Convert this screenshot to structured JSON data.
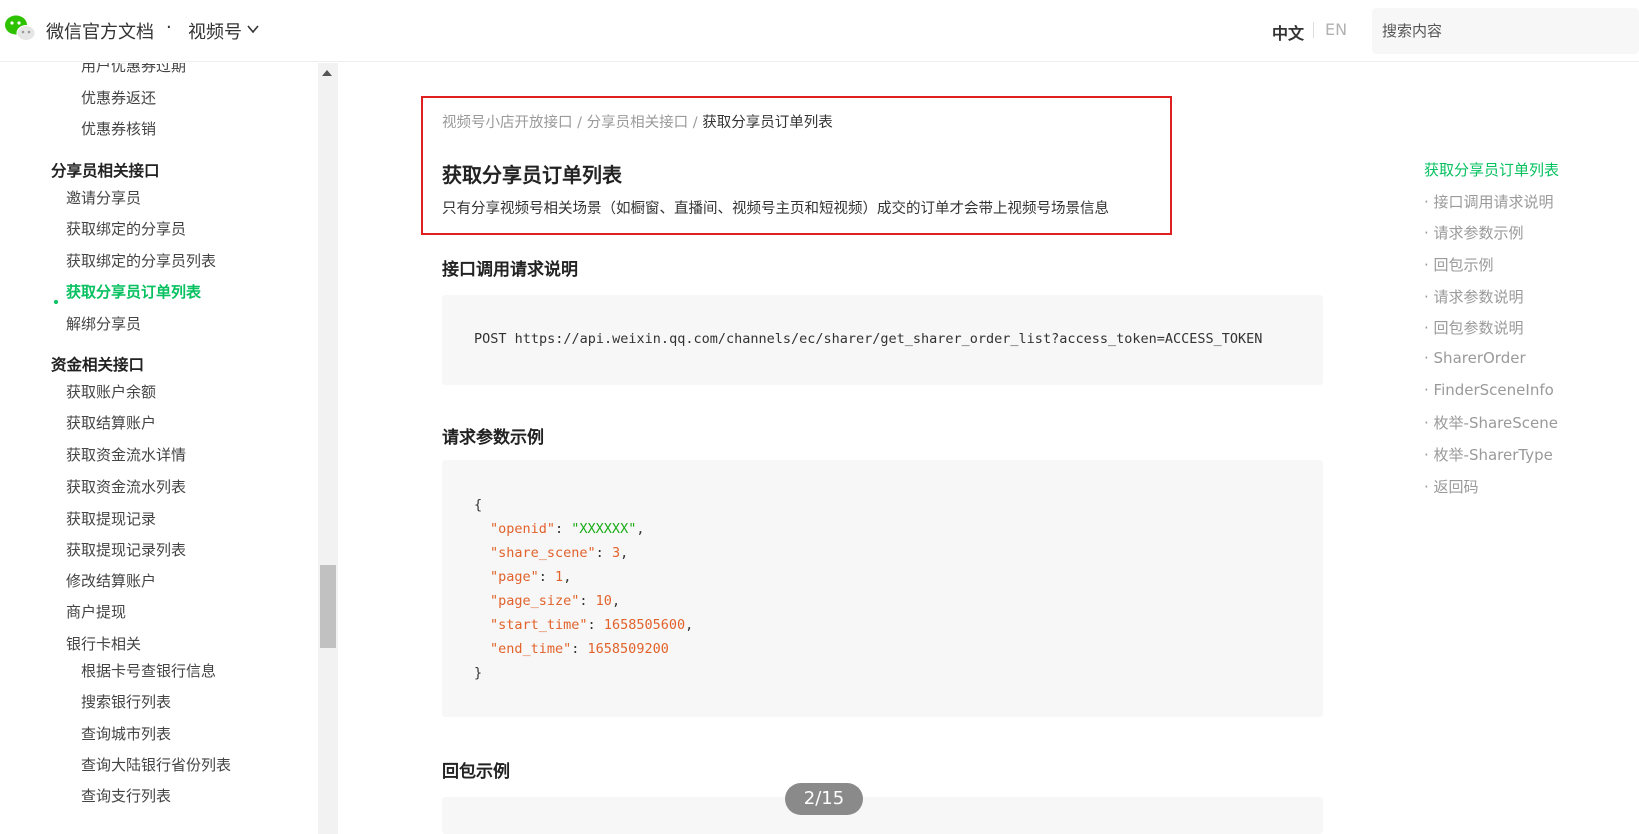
{
  "header": {
    "site_title": "微信官方文档",
    "separator": "·",
    "section_title": "视频号",
    "lang_zh": "中文",
    "lang_en": "EN",
    "search_placeholder": "搜索内容"
  },
  "sidebar": {
    "items": [
      {
        "label": "用户优惠券过期",
        "level": 2
      },
      {
        "label": "优惠券返还",
        "level": 2
      },
      {
        "label": "优惠券核销",
        "level": 2
      },
      {
        "label": "分享员相关接口",
        "level": 0
      },
      {
        "label": "邀请分享员",
        "level": 1
      },
      {
        "label": "获取绑定的分享员",
        "level": 1
      },
      {
        "label": "获取绑定的分享员列表",
        "level": 1
      },
      {
        "label": "获取分享员订单列表",
        "level": 1,
        "active": true
      },
      {
        "label": "解绑分享员",
        "level": 1
      },
      {
        "label": "资金相关接口",
        "level": 0
      },
      {
        "label": "获取账户余额",
        "level": 1
      },
      {
        "label": "获取结算账户",
        "level": 1
      },
      {
        "label": "获取资金流水详情",
        "level": 1
      },
      {
        "label": "获取资金流水列表",
        "level": 1
      },
      {
        "label": "获取提现记录",
        "level": 1
      },
      {
        "label": "获取提现记录列表",
        "level": 1
      },
      {
        "label": "修改结算账户",
        "level": 1
      },
      {
        "label": "商户提现",
        "level": 1
      },
      {
        "label": "银行卡相关",
        "level": 1
      },
      {
        "label": "根据卡号查银行信息",
        "level": 2
      },
      {
        "label": "搜索银行列表",
        "level": 2
      },
      {
        "label": "查询城市列表",
        "level": 2
      },
      {
        "label": "查询大陆银行省份列表",
        "level": 2
      },
      {
        "label": "查询支行列表",
        "level": 2
      }
    ]
  },
  "breadcrumb": {
    "items": [
      "视频号小店开放接口",
      "分享员相关接口",
      "获取分享员订单列表"
    ],
    "separator": "/"
  },
  "main": {
    "title": "获取分享员订单列表",
    "description": "只有分享视频号相关场景（如橱窗、直播间、视频号主页和短视频）成交的订单才会带上视频号场景信息",
    "section1_title": "接口调用请求说明",
    "request_line": "POST https://api.weixin.qq.com/channels/ec/sharer/get_sharer_order_list?access_token=ACCESS_TOKEN",
    "section2_title": "请求参数示例",
    "json_example": {
      "open": "{",
      "close": "}",
      "fields": [
        {
          "key": "\"openid\"",
          "value": "\"XXXXXX\"",
          "type": "string",
          "comma": ","
        },
        {
          "key": "\"share_scene\"",
          "value": "3",
          "type": "number",
          "comma": ","
        },
        {
          "key": "\"page\"",
          "value": "1",
          "type": "number",
          "comma": ","
        },
        {
          "key": "\"page_size\"",
          "value": "10",
          "type": "number",
          "comma": ","
        },
        {
          "key": "\"start_time\"",
          "value": "1658505600",
          "type": "number",
          "comma": ","
        },
        {
          "key": "\"end_time\"",
          "value": "1658509200",
          "type": "number",
          "comma": ""
        }
      ]
    },
    "section3_title": "回包示例"
  },
  "toc": {
    "items": [
      {
        "label": "获取分享员订单列表",
        "active": true
      },
      {
        "label": "· 接口调用请求说明"
      },
      {
        "label": "· 请求参数示例"
      },
      {
        "label": "· 回包示例"
      },
      {
        "label": "· 请求参数说明"
      },
      {
        "label": "· 回包参数说明"
      },
      {
        "label": "· SharerOrder"
      },
      {
        "label": "· FinderSceneInfo"
      },
      {
        "label": "· 枚举-ShareScene"
      },
      {
        "label": "· 枚举-SharerType"
      },
      {
        "label": "· 返回码"
      }
    ]
  },
  "pager": {
    "label": "2/15"
  },
  "colors": {
    "accent": "#07c160",
    "highlight": "#e02020",
    "code_key": "#e2622b",
    "code_string": "#1aad19"
  }
}
